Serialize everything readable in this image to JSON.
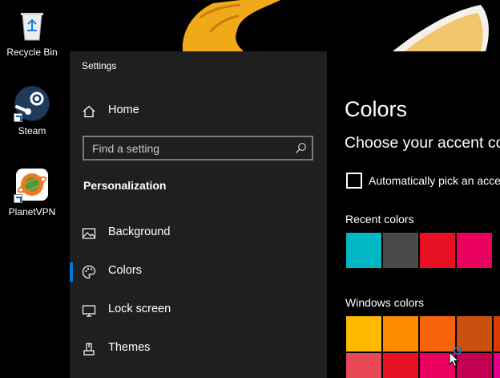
{
  "desktop": {
    "icons": [
      {
        "label": "Recycle Bin",
        "icon": "recycle-bin-icon"
      },
      {
        "label": "Steam",
        "icon": "steam-icon"
      },
      {
        "label": "PlanetVPN",
        "icon": "planetvpn-icon"
      }
    ]
  },
  "window": {
    "title": "Settings"
  },
  "sidebar": {
    "home_label": "Home",
    "home_icon": "home-icon",
    "search_placeholder": "Find a setting",
    "section_heading": "Personalization",
    "items": [
      {
        "label": "Background",
        "icon": "image-icon",
        "selected": false
      },
      {
        "label": "Colors",
        "icon": "palette-icon",
        "selected": true
      },
      {
        "label": "Lock screen",
        "icon": "monitor-icon",
        "selected": false
      },
      {
        "label": "Themes",
        "icon": "brush-icon",
        "selected": false
      }
    ]
  },
  "main": {
    "title": "Colors",
    "subtitle": "Choose your accent color",
    "auto_pick_label": "Automatically pick an accent color from my background",
    "auto_pick_checked": false,
    "recent_colors_label": "Recent colors",
    "recent_colors": [
      "#00b7c3",
      "#4c4a48",
      "#e81123",
      "#ea005e"
    ],
    "windows_colors_label": "Windows colors",
    "windows_colors_row1": [
      "#ffb900",
      "#ff8c00",
      "#f7630c",
      "#ca5010",
      "#da3b01"
    ],
    "windows_colors_row2": [
      "#e74856",
      "#e81123",
      "#ea005e",
      "#c30052",
      "#e3008c"
    ]
  },
  "theme": {
    "accent": "#0078d7",
    "sidebar_bg": "#1f1f1f",
    "content_bg": "#000000"
  }
}
